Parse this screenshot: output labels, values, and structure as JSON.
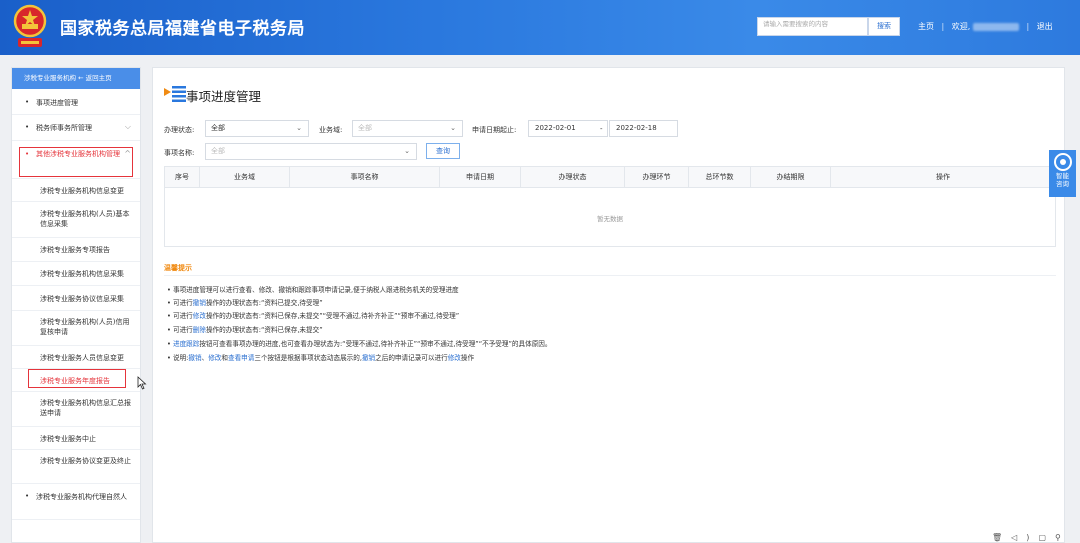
{
  "header": {
    "title": "国家税务总局福建省电子税务局",
    "search_placeholder": "请输入需要搜索的内容",
    "search_button": "搜索",
    "home": "主页",
    "welcome": "欢迎,",
    "logout": "退出",
    "separator": "|"
  },
  "sidebar": {
    "head": "涉税专业服务机构 ← 返回主页",
    "top_items": [
      {
        "label": "事项进度管理"
      },
      {
        "label": "税务师事务所管理"
      },
      {
        "label": "其他涉税专业服务机构管理"
      }
    ],
    "sub_items": [
      {
        "label": "涉税专业服务机构信息变更"
      },
      {
        "label": "涉税专业服务机构(人员)基本信息采集"
      },
      {
        "label": "涉税专业服务专项报告"
      },
      {
        "label": "涉税专业服务机构信息采集"
      },
      {
        "label": "涉税专业服务协议信息采集"
      },
      {
        "label": "涉税专业服务机构(人员)信用复核申请"
      },
      {
        "label": "涉税专业服务人员信息变更"
      },
      {
        "label": "涉税专业服务年度报告"
      },
      {
        "label": "涉税专业服务机构信息汇总报送申请"
      },
      {
        "label": "涉税专业服务中止"
      },
      {
        "label": "涉税专业服务协议变更及终止"
      }
    ],
    "bottom_item": {
      "label": "涉税专业服务机构代理自然人"
    }
  },
  "main": {
    "title": "事项进度管理",
    "filters": {
      "status_label": "办理状态:",
      "status_value": "全部",
      "domain_label": "业务域:",
      "domain_placeholder": "全部",
      "date_label": "申请日期起止:",
      "date_from": "2022-02-01",
      "date_sep": "-",
      "date_to": "2022-02-18",
      "name_label": "事项名称:",
      "name_placeholder": "全部",
      "query_button": "查询"
    },
    "table": {
      "headers": [
        "序号",
        "业务域",
        "事项名称",
        "申请日期",
        "办理状态",
        "办理环节",
        "总环节数",
        "办结期限",
        "操作"
      ],
      "empty_text": "暂无数据"
    },
    "tips": {
      "title": "温馨提示",
      "lines": [
        {
          "parts": [
            {
              "t": "事项进度管理可以进行查看、修改、撤销和跟踪事项申请记录,便于纳税人跟进税务机关的受理进度",
              "b": false
            }
          ]
        },
        {
          "parts": [
            {
              "t": "可进行",
              "b": false
            },
            {
              "t": "撤销",
              "b": true
            },
            {
              "t": "操作的办理状态有:“资料已提交,待受理”",
              "b": false
            }
          ]
        },
        {
          "parts": [
            {
              "t": "可进行",
              "b": false
            },
            {
              "t": "修改",
              "b": true
            },
            {
              "t": "操作的办理状态有:“资料已保存,未提交”“受理不通过,待补齐补正”“预审不通过,待受理”",
              "b": false
            }
          ]
        },
        {
          "parts": [
            {
              "t": "可进行",
              "b": false
            },
            {
              "t": "删除",
              "b": true
            },
            {
              "t": "操作的办理状态有:“资料已保存,未提交”",
              "b": false
            }
          ]
        },
        {
          "parts": [
            {
              "t": "进度跟踪",
              "b": true
            },
            {
              "t": "按钮可查看事项办理的进度,也可查看办理状态为:“受理不通过,待补齐补正”“预审不通过,待受理”“不予受理”的具体原因。",
              "b": false
            }
          ]
        },
        {
          "parts": [
            {
              "t": "说明:",
              "b": false
            },
            {
              "t": "撤销",
              "b": true
            },
            {
              "t": "、",
              "b": false
            },
            {
              "t": "修改",
              "b": true
            },
            {
              "t": "和",
              "b": false
            },
            {
              "t": "查看申请",
              "b": true
            },
            {
              "t": "三个按钮是根据事项状态动态展示的,",
              "b": false
            },
            {
              "t": "撤销",
              "b": true
            },
            {
              "t": "之后的申请记录可以进行",
              "b": false
            },
            {
              "t": "修改",
              "b": true
            },
            {
              "t": "操作",
              "b": false
            }
          ]
        }
      ]
    }
  },
  "float_help": {
    "label": "智能咨询"
  },
  "colors": {
    "brand": "#2a78de",
    "accent_red": "#e5343b",
    "link": "#2a6fd0",
    "tip_title": "#f08a12"
  }
}
